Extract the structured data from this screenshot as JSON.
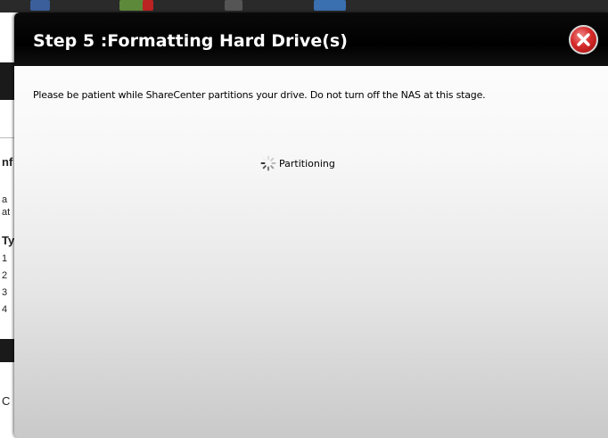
{
  "dialog": {
    "title": "Step 5 :Formatting Hard Drive(s)",
    "message": "Please be patient while ShareCenter partitions your drive. Do not turn off the NAS at this stage.",
    "status": "Partitioning",
    "status_icon": "loading-spinner-icon",
    "close_icon": "close-icon"
  },
  "background_fragments": [
    "nf",
    "a",
    "at",
    "Ty",
    "1",
    "2",
    "3",
    "4",
    "C"
  ],
  "colors": {
    "header": "#000000",
    "title_text": "#ffffff",
    "close_button": "#d62a2a"
  }
}
